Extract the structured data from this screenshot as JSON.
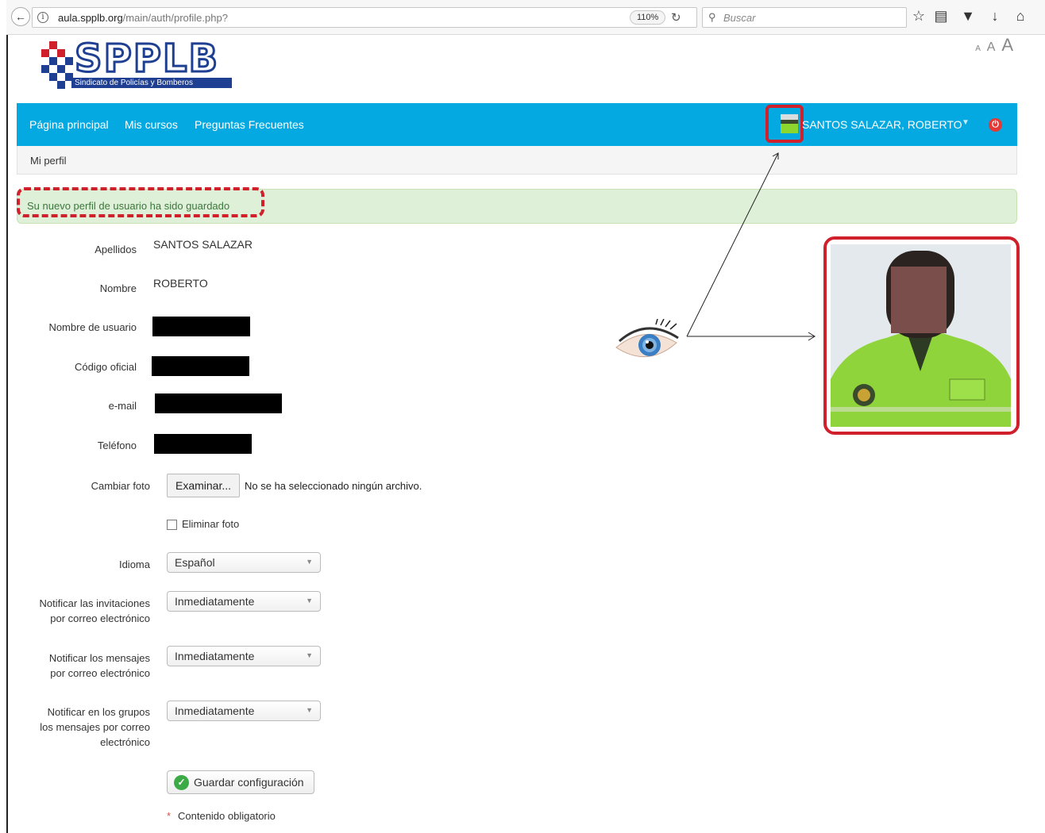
{
  "browser": {
    "url_host": "aula.spplb.org",
    "url_path": "/main/auth/profile.php?",
    "zoom": "110%",
    "search_placeholder": "Buscar",
    "icons": [
      "back-icon",
      "info-icon",
      "reload-icon",
      "search-icon",
      "bookmark-star-icon",
      "reader-list-icon",
      "pocket-icon",
      "download-icon",
      "home-icon"
    ]
  },
  "font_controls": {
    "small": "A",
    "medium": "A",
    "large": "A"
  },
  "logo": {
    "name": "SPPLB",
    "subtitle": "Sindicato de Policías y Bomberos"
  },
  "nav": {
    "links": [
      "Página principal",
      "Mis cursos",
      "Preguntas Frecuentes"
    ],
    "user": "SANTOS SALAZAR, ROBERTO",
    "accent": "#03a9e0",
    "logout_color": "#e53935"
  },
  "breadcrumb": "Mi perfil",
  "alert": {
    "message": "Su nuevo perfil de usuario ha sido guardado",
    "color": "#3c763d",
    "background": "#dff0d8"
  },
  "form": {
    "fields": [
      {
        "label": "Apellidos",
        "value": "SANTOS SALAZAR"
      },
      {
        "label": "Nombre",
        "value": "ROBERTO"
      },
      {
        "label": "Nombre de usuario",
        "value": "",
        "redacted": true
      },
      {
        "label": "Código oficial",
        "value": "",
        "redacted": true
      },
      {
        "label": "e-mail",
        "value": "",
        "redacted": true
      },
      {
        "label": "Teléfono",
        "value": "",
        "redacted": true
      }
    ],
    "photo": {
      "label": "Cambiar foto",
      "button": "Examinar...",
      "status": "No se ha seleccionado ningún archivo.",
      "delete_label": "Eliminar foto",
      "delete_checked": false
    },
    "language": {
      "label": "Idioma",
      "value": "Español"
    },
    "notify_invitations": {
      "label_line1": "Notificar las invitaciones",
      "label_line2": "por correo electrónico",
      "value": "Inmediatamente"
    },
    "notify_messages": {
      "label_line1": "Notificar los mensajes",
      "label_line2": "por correo electrónico",
      "value": "Inmediatamente"
    },
    "notify_groups": {
      "label_line1": "Notificar en los grupos",
      "label_line2": "los mensajes por correo",
      "label_line3": "electrónico",
      "value": "Inmediatamente"
    },
    "save_button": "Guardar configuración",
    "required_star": "*",
    "required_note": "Contenido obligatorio"
  },
  "annotation": {
    "highlight_color": "#d0202c"
  }
}
